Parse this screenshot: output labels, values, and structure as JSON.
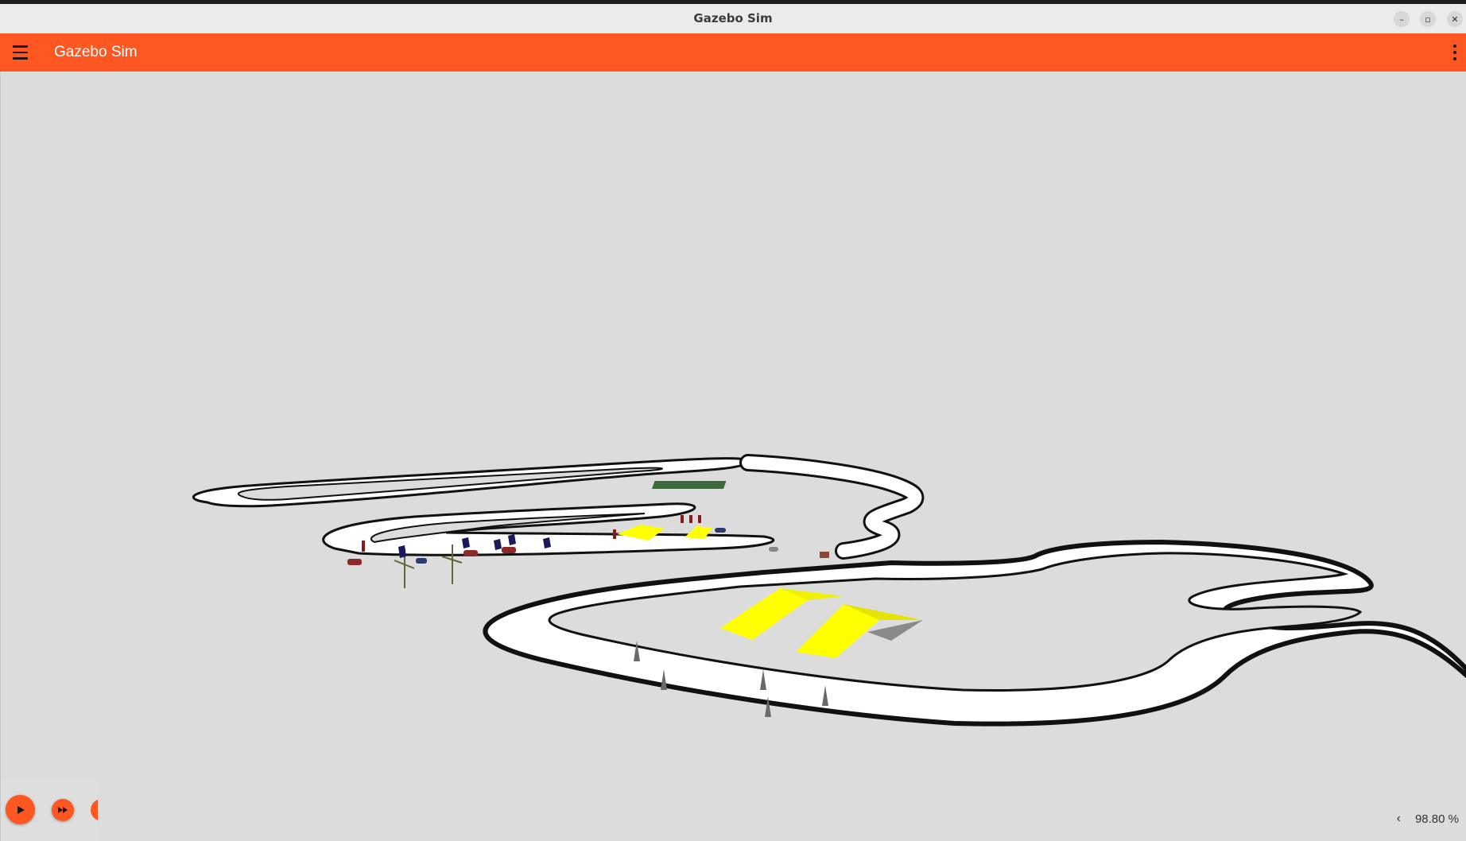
{
  "window": {
    "title": "Gazebo Sim",
    "buttons": {
      "minimize": "–",
      "restore": "▫",
      "close": "✕"
    }
  },
  "appbar": {
    "title": "Gazebo Sim",
    "accent_color": "#ff5722",
    "menu_icon": "hamburger-menu-icon",
    "overflow_icon": "more-vertical-icon"
  },
  "playback": {
    "play_icon": "play-icon",
    "step_icon": "fast-forward-icon"
  },
  "stats": {
    "expand_icon": "chevron-left-icon",
    "real_time_factor": "98.80 %"
  }
}
